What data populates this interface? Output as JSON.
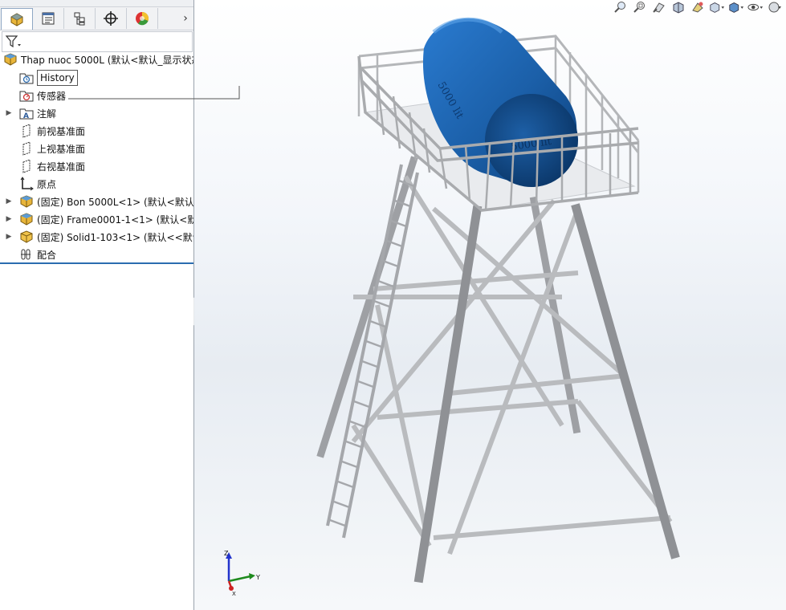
{
  "feature_tree": {
    "root_label": "Thap nuoc 5000L  (默认<默认_显示状态",
    "items": [
      {
        "label": "History"
      },
      {
        "label": "传感器"
      },
      {
        "label": "注解"
      },
      {
        "label": "前视基准面"
      },
      {
        "label": "上视基准面"
      },
      {
        "label": "右视基准面"
      },
      {
        "label": "原点"
      },
      {
        "label": "(固定) Bon 5000L<1> (默认<默认_"
      },
      {
        "label": "(固定) Frame0001-1<1> (默认<默"
      },
      {
        "label": "(固定) Solid1-103<1> (默认<<默认"
      },
      {
        "label": "配合"
      }
    ]
  },
  "tabs": [
    {
      "icon": "feature-manager-icon"
    },
    {
      "icon": "property-manager-icon"
    },
    {
      "icon": "configuration-manager-icon"
    },
    {
      "icon": "dimxpert-icon"
    },
    {
      "icon": "display-manager-icon"
    }
  ],
  "view_toolbar_icons": [
    "zoom-to-fit-icon",
    "zoom-area-icon",
    "previous-view-icon",
    "section-view-icon",
    "dynamic-annotation-icon",
    "view-orientation-icon",
    "display-style-icon",
    "hide-show-icon",
    "appearance-icon"
  ],
  "model": {
    "tank_label_side": "5000 lit",
    "tank_label_end": "5000 lit",
    "tank_color": "#1b5fa8",
    "frame_color": "#a9abae"
  },
  "triad": {
    "z": "Z",
    "y": "Y",
    "x": "X"
  },
  "colors": {
    "accent": "#2b6cb0",
    "viewport_bg": "#eef2f6"
  }
}
